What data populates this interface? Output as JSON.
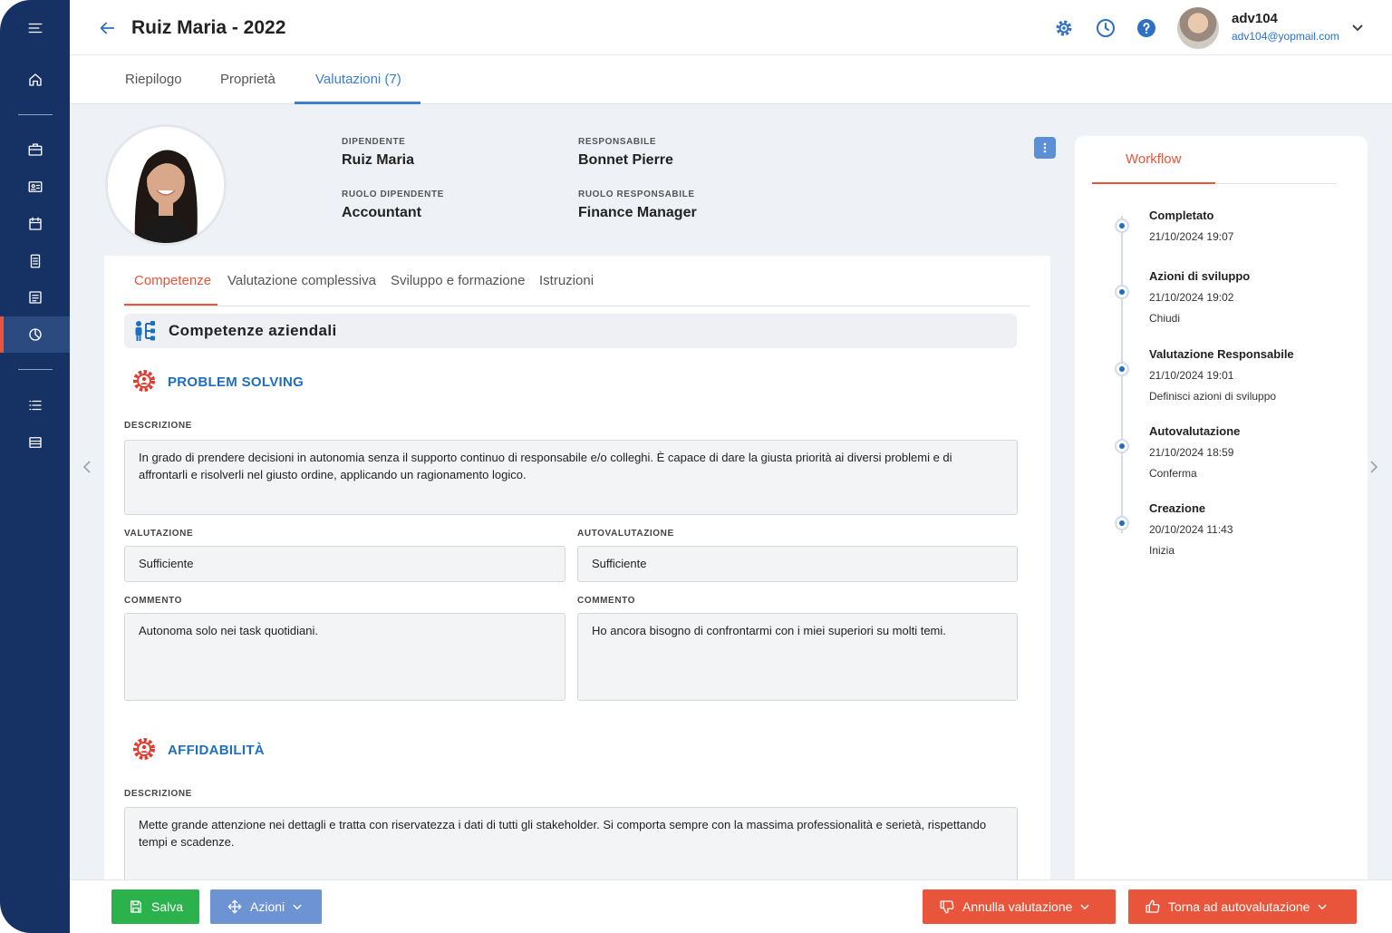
{
  "header": {
    "title": "Ruiz Maria - 2022",
    "user_name": "adv104",
    "user_email": "adv104@yopmail.com"
  },
  "top_tabs": [
    {
      "label": "Riepilogo"
    },
    {
      "label": "Proprietà"
    },
    {
      "label": "Valutazioni (7)"
    }
  ],
  "profile": {
    "employee_label": "DIPENDENTE",
    "employee_value": "Ruiz Maria",
    "manager_label": "RESPONSABILE",
    "manager_value": "Bonnet Pierre",
    "employee_role_label": "RUOLO DIPENDENTE",
    "employee_role_value": "Accountant",
    "manager_role_label": "RUOLO RESPONSABILE",
    "manager_role_value": "Finance Manager"
  },
  "sub_tabs": [
    {
      "label": "Competenze"
    },
    {
      "label": "Valutazione complessiva"
    },
    {
      "label": "Sviluppo e formazione"
    },
    {
      "label": "Istruzioni"
    }
  ],
  "section": {
    "title": "Competenze aziendali"
  },
  "competencies": [
    {
      "title": "PROBLEM SOLVING",
      "description_label": "DESCRIZIONE",
      "description": "In grado di prendere decisioni in autonomia senza il supporto continuo di responsabile e/o colleghi. È capace di dare la giusta priorità ai diversi problemi e di affrontarli e risolverli nel giusto ordine, applicando un ragionamento logico.",
      "rating_label": "VALUTAZIONE",
      "rating_value": "Sufficiente",
      "self_rating_label": "AUTOVALUTAZIONE",
      "self_rating_value": "Sufficiente",
      "comment_label": "COMMENTO",
      "comment": "Autonoma solo nei task quotidiani.",
      "self_comment_label": "COMMENTO",
      "self_comment": "Ho ancora bisogno di confrontarmi con i miei superiori su molti temi."
    },
    {
      "title": "AFFIDABILITÀ",
      "description_label": "DESCRIZIONE",
      "description": "Mette grande attenzione nei dettagli e tratta con riservatezza i dati di tutti gli stakeholder. Si comporta sempre con la massima professionalità e serietà, rispettando tempi e scadenze."
    }
  ],
  "workflow": {
    "tab_label": "Workflow",
    "steps": [
      {
        "title": "Completato",
        "date": "21/10/2024 19:07",
        "action": ""
      },
      {
        "title": "Azioni di sviluppo",
        "date": "21/10/2024 19:02",
        "action": "Chiudi"
      },
      {
        "title": "Valutazione Responsabile",
        "date": "21/10/2024 19:01",
        "action": "Definisci azioni di sviluppo"
      },
      {
        "title": "Autovalutazione",
        "date": "21/10/2024 18:59",
        "action": "Conferma"
      },
      {
        "title": "Creazione",
        "date": "20/10/2024 11:43",
        "action": "Inizia"
      }
    ]
  },
  "footer": {
    "save_label": "Salva",
    "actions_label": "Azioni",
    "cancel_label": "Annulla valutazione",
    "back_label": "Torna ad autovalutazione"
  },
  "colors": {
    "sidebar": "#163264",
    "accent_blue": "#3f7fcf",
    "accent_orange": "#e8553a",
    "save_green": "#2bb24c"
  },
  "icons": {
    "sidebar": [
      "menu-icon",
      "home-icon",
      "briefcase-icon",
      "id-card-icon",
      "calendar-icon",
      "document-icon",
      "list-doc-icon",
      "chart-pie-icon",
      "list-icon",
      "table-icon"
    ],
    "header": [
      "gear-icon",
      "clock-icon",
      "help-icon"
    ]
  }
}
